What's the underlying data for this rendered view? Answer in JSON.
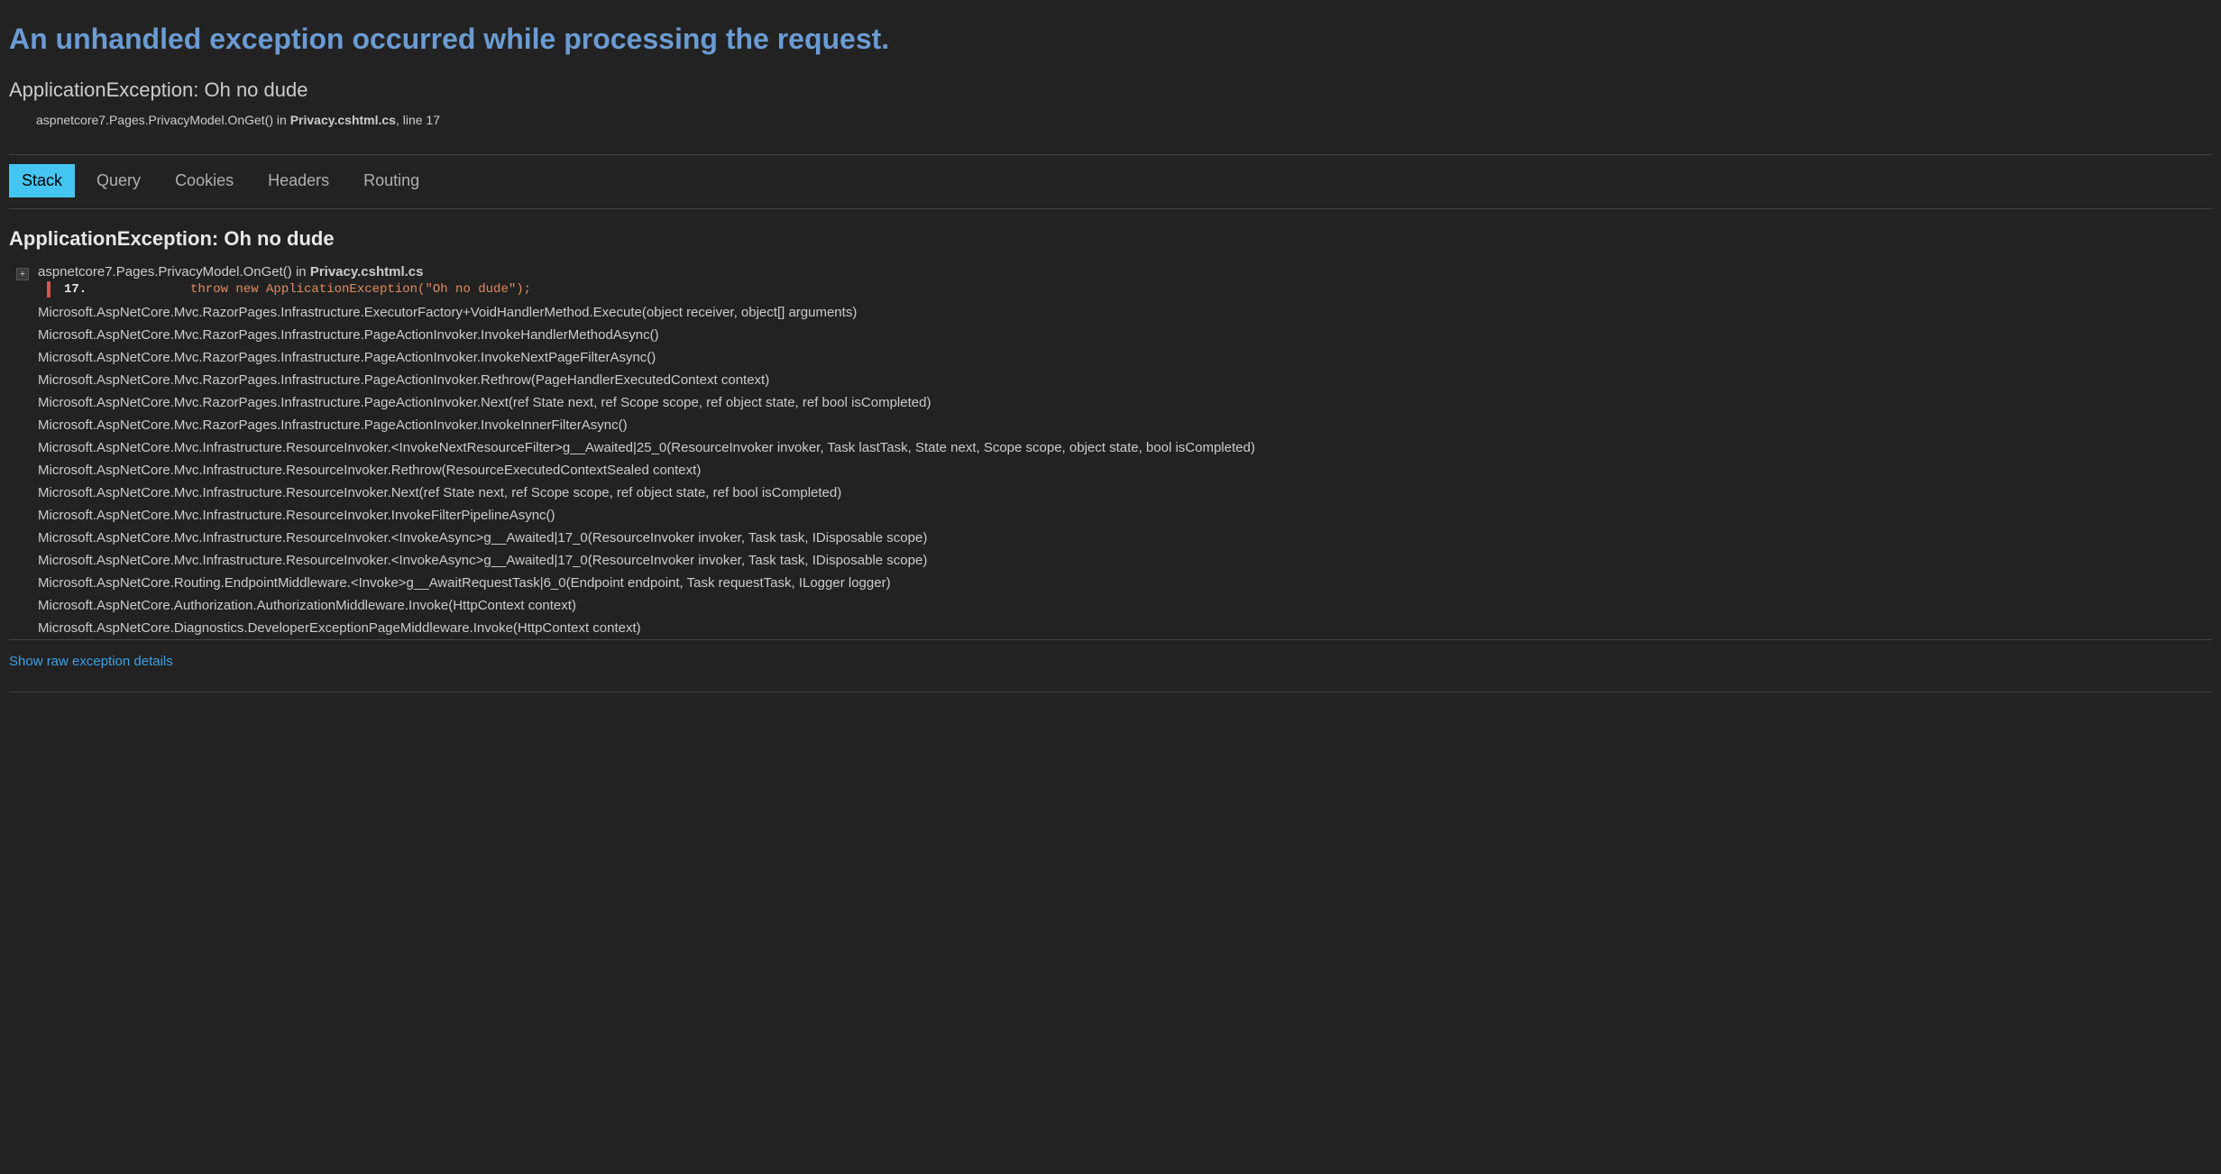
{
  "header": {
    "title": "An unhandled exception occurred while processing the request.",
    "exception_type": "ApplicationException",
    "exception_message": "Oh no dude",
    "location_class": "aspnetcore7.Pages.PrivacyModel.OnGet() in",
    "location_file": "Privacy.cshtml.cs",
    "location_line_text": ", line 17"
  },
  "tabs": {
    "stack": "Stack",
    "query": "Query",
    "cookies": "Cookies",
    "headers": "Headers",
    "routing": "Routing"
  },
  "detail": {
    "heading": "ApplicationException: Oh no dude",
    "top_frame": {
      "text_prefix": "aspnetcore7.Pages.PrivacyModel.OnGet() in",
      "file": "Privacy.cshtml.cs",
      "expand_symbol": "+",
      "line_number": "17.",
      "code": "throw new ApplicationException(\"Oh no dude\");"
    },
    "frames": [
      "Microsoft.AspNetCore.Mvc.RazorPages.Infrastructure.ExecutorFactory+VoidHandlerMethod.Execute(object receiver, object[] arguments)",
      "Microsoft.AspNetCore.Mvc.RazorPages.Infrastructure.PageActionInvoker.InvokeHandlerMethodAsync()",
      "Microsoft.AspNetCore.Mvc.RazorPages.Infrastructure.PageActionInvoker.InvokeNextPageFilterAsync()",
      "Microsoft.AspNetCore.Mvc.RazorPages.Infrastructure.PageActionInvoker.Rethrow(PageHandlerExecutedContext context)",
      "Microsoft.AspNetCore.Mvc.RazorPages.Infrastructure.PageActionInvoker.Next(ref State next, ref Scope scope, ref object state, ref bool isCompleted)",
      "Microsoft.AspNetCore.Mvc.RazorPages.Infrastructure.PageActionInvoker.InvokeInnerFilterAsync()",
      "Microsoft.AspNetCore.Mvc.Infrastructure.ResourceInvoker.<InvokeNextResourceFilter>g__Awaited|25_0(ResourceInvoker invoker, Task lastTask, State next, Scope scope, object state, bool isCompleted)",
      "Microsoft.AspNetCore.Mvc.Infrastructure.ResourceInvoker.Rethrow(ResourceExecutedContextSealed context)",
      "Microsoft.AspNetCore.Mvc.Infrastructure.ResourceInvoker.Next(ref State next, ref Scope scope, ref object state, ref bool isCompleted)",
      "Microsoft.AspNetCore.Mvc.Infrastructure.ResourceInvoker.InvokeFilterPipelineAsync()",
      "Microsoft.AspNetCore.Mvc.Infrastructure.ResourceInvoker.<InvokeAsync>g__Awaited|17_0(ResourceInvoker invoker, Task task, IDisposable scope)",
      "Microsoft.AspNetCore.Mvc.Infrastructure.ResourceInvoker.<InvokeAsync>g__Awaited|17_0(ResourceInvoker invoker, Task task, IDisposable scope)",
      "Microsoft.AspNetCore.Routing.EndpointMiddleware.<Invoke>g__AwaitRequestTask|6_0(Endpoint endpoint, Task requestTask, ILogger logger)",
      "Microsoft.AspNetCore.Authorization.AuthorizationMiddleware.Invoke(HttpContext context)",
      "Microsoft.AspNetCore.Diagnostics.DeveloperExceptionPageMiddleware.Invoke(HttpContext context)"
    ]
  },
  "footer": {
    "raw_link": "Show raw exception details"
  }
}
